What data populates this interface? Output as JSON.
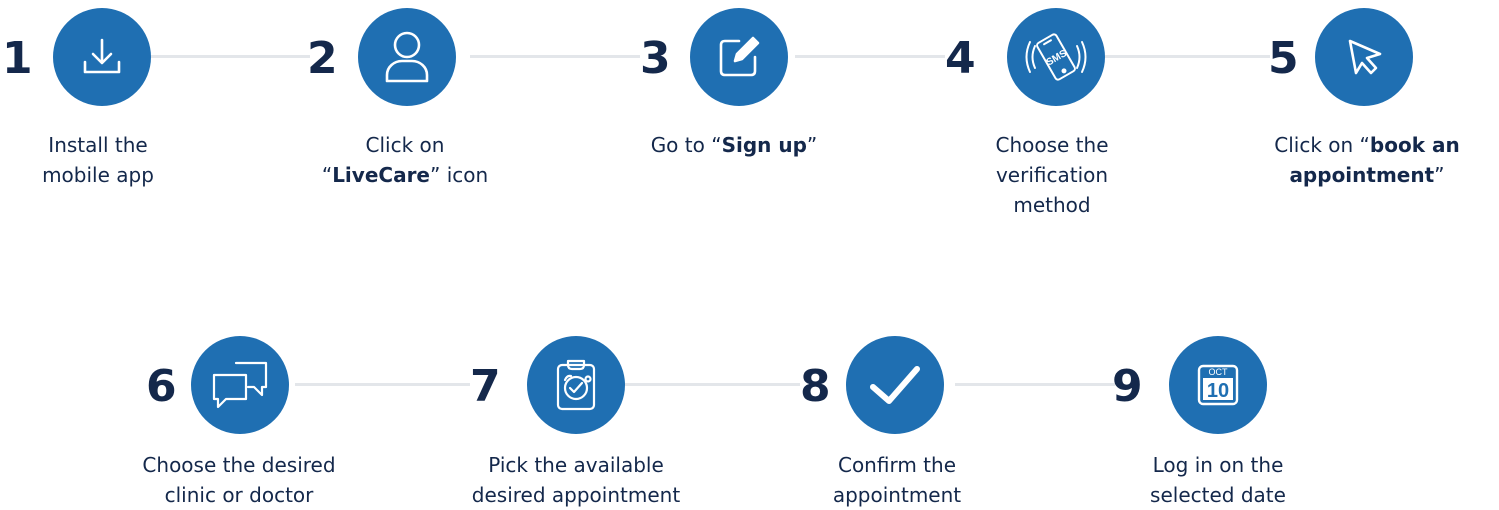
{
  "steps": [
    {
      "number": "1",
      "icon": "download-icon",
      "line1": "Install the",
      "line2": "mobile app"
    },
    {
      "number": "2",
      "icon": "user-icon",
      "line1": "Click on",
      "line2_open": "“",
      "line2_bold": "LiveCare",
      "line2_close": "” icon"
    },
    {
      "number": "3",
      "icon": "edit-icon",
      "line1_pre": "Go to “",
      "line1_bold": "Sign up",
      "line1_post": "”"
    },
    {
      "number": "4",
      "icon": "sms-phone-icon",
      "line1": "Choose the",
      "line2": "verification",
      "line3": "method",
      "icon_text": "SMS"
    },
    {
      "number": "5",
      "icon": "cursor-icon",
      "line1_pre": "Click on “",
      "line1_bold": "book an",
      "line2_bold": "appointment",
      "line2_post": "”"
    },
    {
      "number": "6",
      "icon": "chat-icon",
      "line1": "Choose the desired",
      "line2": "clinic or doctor"
    },
    {
      "number": "7",
      "icon": "clipboard-stethoscope-icon",
      "line1": "Pick the available",
      "line2": "desired appointment"
    },
    {
      "number": "8",
      "icon": "checkmark-icon",
      "line1": "Confirm the",
      "line2": "appointment"
    },
    {
      "number": "9",
      "icon": "calendar-icon",
      "line1": "Log in on the",
      "line2": "selected date",
      "cal_month": "OCT",
      "cal_day": "10"
    }
  ],
  "colors": {
    "accent": "#1f6fb2",
    "text": "#14284b",
    "connector": "#e3e6ea"
  }
}
